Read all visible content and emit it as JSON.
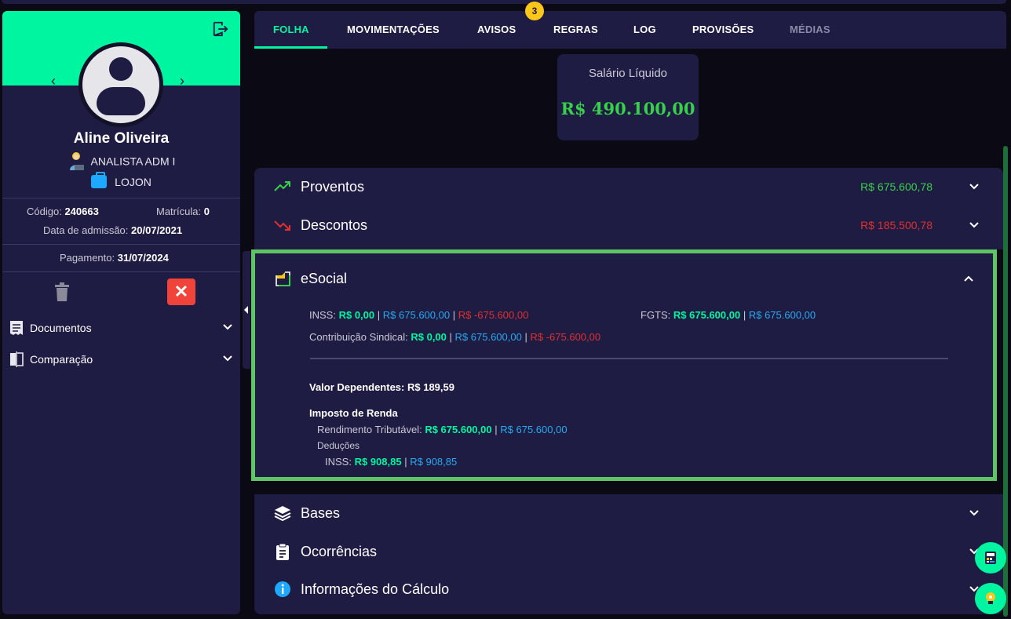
{
  "sidebar": {
    "name": "Aline Oliveira",
    "role": "ANALISTA ADM I",
    "company": "LOJON",
    "codigo_label": "Código:",
    "codigo": "240663",
    "matricula_label": "Matrícula:",
    "matricula": "0",
    "admissao_label": "Data de admissão:",
    "admissao": "20/07/2021",
    "pagamento_label": "Pagamento:",
    "pagamento": "31/07/2024",
    "menu": [
      {
        "label": "Documentos",
        "icon": "receipt-icon"
      },
      {
        "label": "Comparação",
        "icon": "compare-icon"
      }
    ]
  },
  "tabs": [
    {
      "label": "FOLHA",
      "state": "active"
    },
    {
      "label": "MOVIMENTAÇÕES",
      "state": "normal"
    },
    {
      "label": "AVISOS",
      "state": "normal",
      "badge": "3"
    },
    {
      "label": "REGRAS",
      "state": "normal"
    },
    {
      "label": "LOG",
      "state": "normal"
    },
    {
      "label": "PROVISÕES",
      "state": "normal"
    },
    {
      "label": "MÉDIAS",
      "state": "disabled"
    }
  ],
  "salary": {
    "label": "Salário Líquido",
    "value": "R$ 490.100,00"
  },
  "sections": {
    "proventos": {
      "title": "Proventos",
      "value": "R$ 675.600,78",
      "color": "#38d04a"
    },
    "descontos": {
      "title": "Descontos",
      "value": "R$ 185.500,78",
      "color": "#e03030"
    },
    "esocial": {
      "title": "eSocial"
    },
    "bases": {
      "title": "Bases"
    },
    "ocorrencias": {
      "title": "Ocorrências"
    },
    "informacoes": {
      "title": "Informações do Cálculo"
    }
  },
  "esocial": {
    "inss_label": "INSS:",
    "inss_green": "R$ 0,00",
    "inss_blue": "R$ 675.600,00",
    "inss_red": "R$ -675.600,00",
    "fgts_label": "FGTS:",
    "fgts_green": "R$ 675.600,00",
    "fgts_blue": "R$ 675.600,00",
    "sindical_label": "Contribuição Sindical:",
    "sindical_green": "R$ 0,00",
    "sindical_blue": "R$ 675.600,00",
    "sindical_red": "R$ -675.600,00",
    "dependentes": "Valor Dependentes: R$ 189,59",
    "ir_title": "Imposto de Renda",
    "rendimento_label": "Rendimento Tributável:",
    "rendimento_green": "R$ 675.600,00",
    "rendimento_blue": "R$ 675.600,00",
    "deducoes_label": "Deduções",
    "ded_inss_label": "INSS:",
    "ded_inss_green": "R$ 908,85",
    "ded_inss_blue": "R$ 908,85",
    "separator": "|"
  },
  "colors": {
    "accent": "#00f5a0",
    "panel": "#1e1c42",
    "background": "#0b0a14",
    "highlight_border": "#5fc465",
    "blue": "#28aaf0",
    "red": "#e03030"
  }
}
